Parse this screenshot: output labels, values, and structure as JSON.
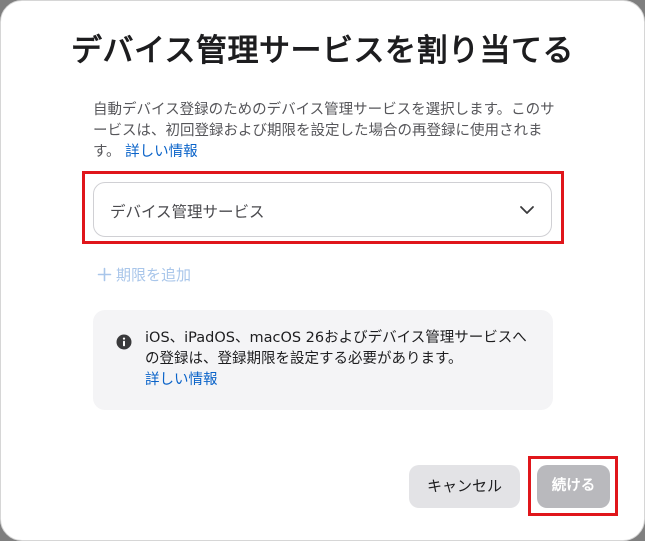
{
  "dialog": {
    "title": "デバイス管理サービスを割り当てる",
    "description_prefix": "自動デバイス登録のためのデバイス管理サービスを選択します。このサービスは、初回登録および期限を設定した場合の再登録に使用されます。",
    "description_link": "詳しい情報",
    "select": {
      "value": "デバイス管理サービス",
      "icon": "chevron-down-icon"
    },
    "add_period_label": "期限を追加",
    "info": {
      "icon": "info-icon",
      "text": "iOS、iPadOS、macOS 26およびデバイス管理サービスへの登録は、登録期限を設定する必要があります。",
      "link": "詳しい情報"
    },
    "buttons": {
      "cancel": "キャンセル",
      "continue": "続ける"
    }
  },
  "colors": {
    "link": "#0a63c9",
    "highlight": "#e0161b",
    "disabled_button": "#b9b9bd",
    "disabled_link": "#a9c6ea"
  }
}
